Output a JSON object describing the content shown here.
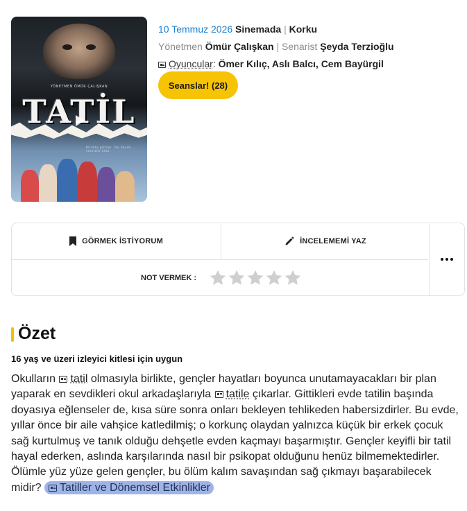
{
  "poster": {
    "director_credit": "YÖNETMEN ÖMÜR ÇALIŞKAN",
    "logo": "TATİL",
    "tagline": "Birlikte gittiler. Tek döndü... sessizlik oldu."
  },
  "meta": {
    "date": "10 Temmuz 2026",
    "status": "Sinemada",
    "divider": "|",
    "genre": "Korku",
    "director_label": "Yönetmen",
    "director": "Ömür Çalışkan",
    "writer_label": "Senarist",
    "writer": "Şeyda Terzioğlu",
    "cast_label": "Oyuncular",
    "cast_colon": ":",
    "cast": "Ömer Kılıç, Aslı Balcı, Cem Bayürgil"
  },
  "seans_button": "Seanslar! (28)",
  "actions": {
    "watchlist": "GÖRMEK İSTİYORUM",
    "review": "İNCELEMEMİ YAZ",
    "rating_label": "NOT VERMEK :"
  },
  "summary": {
    "title": "Özet",
    "age_rating": "16 yaş ve üzeri izleyici kitlesi için uygun",
    "p1": "Okulların ",
    "link1": "tatil",
    "p2": " olmasıyla birlikte, gençler hayatları boyunca unutamayacakları bir plan yaparak en sevdikleri okul arkadaşlarıyla ",
    "link2": "tatile",
    "p3": " çıkarlar. Gittikleri evde tatilin başında doyasıya eğlenseler de, kısa süre sonra onları bekleyen tehlikeden habersizdirler. Bu evde, yıllar önce bir aile vahşice katledilmiş; o korkunç olaydan yalnızca küçük bir erkek çocuk sağ kurtulmuş ve tanık olduğu dehşetle evden kaçmayı başarmıştır. Gençler keyifli bir tatil hayal ederken, aslında karşılarında nasıl bir psikopat olduğunu henüz bilmemektedirler. Ölümle yüz yüze gelen gençler, bu ölüm kalım savaşından sağ çıkmayı başarabilecek midir? ",
    "tag": "Tatiller ve Dönemsel Etkinlikler"
  },
  "colors": {
    "accent": "#f7c305",
    "date_link": "#1a7fd1",
    "tag_bg": "#9fb3e6"
  }
}
